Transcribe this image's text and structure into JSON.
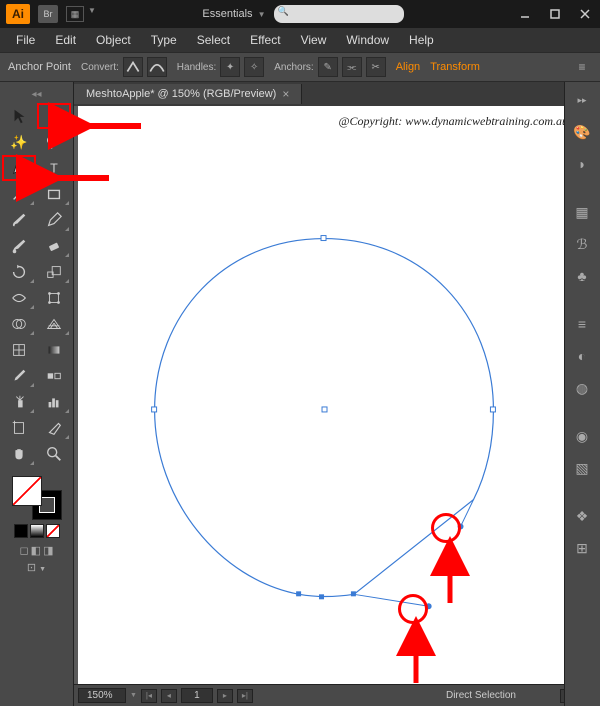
{
  "title_bar": {
    "app": "Ai",
    "bridge": "Br",
    "workspace": "Essentials"
  },
  "menu": [
    "File",
    "Edit",
    "Object",
    "Type",
    "Select",
    "Effect",
    "View",
    "Window",
    "Help"
  ],
  "control": {
    "mode": "Anchor Point",
    "convert": "Convert:",
    "handles": "Handles:",
    "anchors": "Anchors:",
    "align": "Align",
    "transform": "Transform"
  },
  "tab": {
    "name": "MeshtoApple* @ 150% (RGB/Preview)"
  },
  "copyright": "@Copyright: www.dynamicwebtraining.com.au",
  "status": {
    "zoom": "150%",
    "page": "1",
    "tool": "Direct Selection"
  }
}
